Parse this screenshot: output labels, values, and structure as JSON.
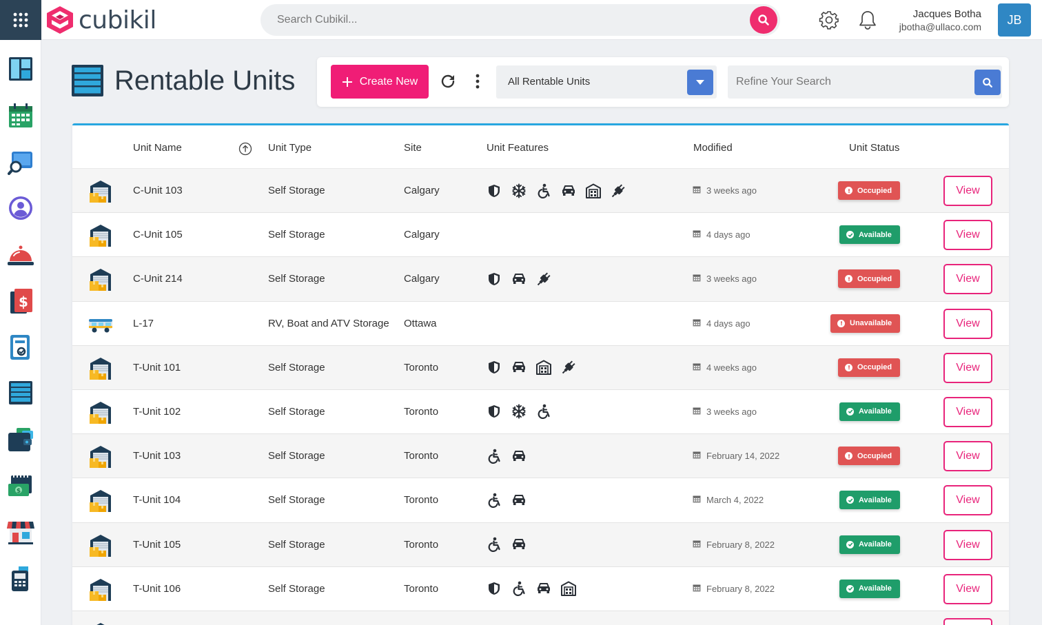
{
  "app": {
    "brand": "cubikil",
    "search_placeholder": "Search Cubikil...",
    "user": {
      "name": "Jacques Botha",
      "email": "jbotha@ullaco.com",
      "initials": "JB"
    },
    "colors": {
      "brand": "#ef2d6e",
      "sidebar_dark": "#2c4356",
      "accent_blue": "#4a7bd4",
      "table_top": "#27a6e0",
      "avatar": "#2f87c4"
    }
  },
  "sidebar": {
    "items": [
      {
        "name": "dashboard-icon"
      },
      {
        "name": "calendar-icon"
      },
      {
        "name": "search-screen-icon"
      },
      {
        "name": "user-profile-icon"
      },
      {
        "name": "service-bell-icon"
      },
      {
        "name": "invoice-icon"
      },
      {
        "name": "payment-document-icon"
      },
      {
        "name": "rentable-units-icon"
      },
      {
        "name": "wallet-icon"
      },
      {
        "name": "billing-calendar-icon"
      },
      {
        "name": "storefront-icon"
      },
      {
        "name": "terminal-icon"
      }
    ]
  },
  "page": {
    "title": "Rentable Units",
    "create_label": "Create New",
    "filter_value": "All Rentable Units",
    "refine_placeholder": "Refine Your Search"
  },
  "table": {
    "columns": {
      "unit_name": "Unit Name",
      "unit_type": "Unit Type",
      "site": "Site",
      "unit_features": "Unit Features",
      "modified": "Modified",
      "unit_status": "Unit Status"
    },
    "view_label": "View",
    "status_colors": {
      "Occupied": "#e05454",
      "Available": "#1f9d6a",
      "Unavailable": "#e05454"
    },
    "rows": [
      {
        "name": "C-Unit 103",
        "type": "Self Storage",
        "site": "Calgary",
        "icon": "storage-unit-icon",
        "features": [
          "security",
          "climate",
          "accessible",
          "vehicle",
          "garage",
          "power"
        ],
        "modified": "3 weeks ago",
        "status": "Occupied"
      },
      {
        "name": "C-Unit 105",
        "type": "Self Storage",
        "site": "Calgary",
        "icon": "storage-unit-icon",
        "features": [],
        "modified": "4 days ago",
        "status": "Available"
      },
      {
        "name": "C-Unit 214",
        "type": "Self Storage",
        "site": "Calgary",
        "icon": "storage-unit-icon",
        "features": [
          "security",
          "vehicle",
          "power"
        ],
        "modified": "3 weeks ago",
        "status": "Occupied"
      },
      {
        "name": "L-17",
        "type": "RV, Boat and ATV Storage",
        "site": "Ottawa",
        "icon": "rv-icon",
        "features": [],
        "modified": "4 days ago",
        "status": "Unavailable"
      },
      {
        "name": "T-Unit 101",
        "type": "Self Storage",
        "site": "Toronto",
        "icon": "storage-unit-icon",
        "features": [
          "security",
          "vehicle",
          "garage",
          "power"
        ],
        "modified": "4 weeks ago",
        "status": "Occupied"
      },
      {
        "name": "T-Unit 102",
        "type": "Self Storage",
        "site": "Toronto",
        "icon": "storage-unit-icon",
        "features": [
          "security",
          "climate",
          "accessible"
        ],
        "modified": "3 weeks ago",
        "status": "Available"
      },
      {
        "name": "T-Unit 103",
        "type": "Self Storage",
        "site": "Toronto",
        "icon": "storage-unit-icon",
        "features": [
          "accessible",
          "vehicle"
        ],
        "modified": "February 14, 2022",
        "status": "Occupied"
      },
      {
        "name": "T-Unit 104",
        "type": "Self Storage",
        "site": "Toronto",
        "icon": "storage-unit-icon",
        "features": [
          "accessible",
          "vehicle"
        ],
        "modified": "March 4, 2022",
        "status": "Available"
      },
      {
        "name": "T-Unit 105",
        "type": "Self Storage",
        "site": "Toronto",
        "icon": "storage-unit-icon",
        "features": [
          "accessible",
          "vehicle"
        ],
        "modified": "February 8, 2022",
        "status": "Available"
      },
      {
        "name": "T-Unit 106",
        "type": "Self Storage",
        "site": "Toronto",
        "icon": "storage-unit-icon",
        "features": [
          "security",
          "accessible",
          "vehicle",
          "garage"
        ],
        "modified": "February 8, 2022",
        "status": "Available"
      },
      {
        "name": "",
        "type": "",
        "site": "",
        "icon": "storage-unit-icon",
        "features": [],
        "modified": "",
        "status": ""
      }
    ]
  }
}
